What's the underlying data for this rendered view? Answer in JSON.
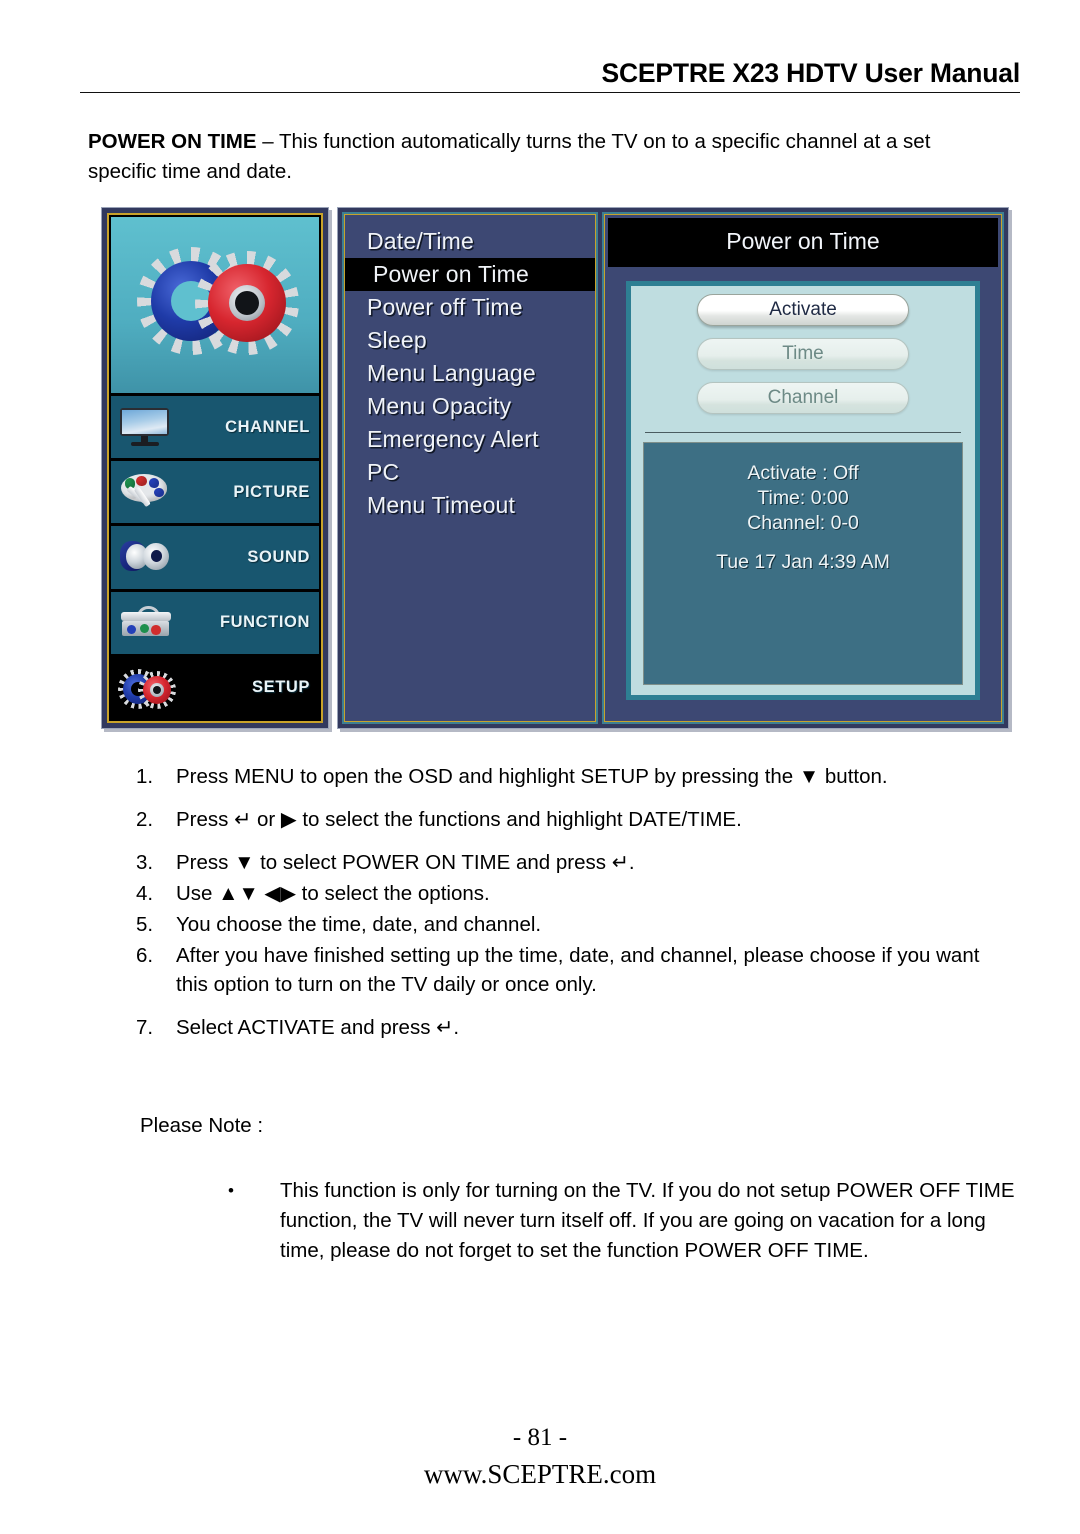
{
  "header": {
    "title": "SCEPTRE X23 HDTV User Manual"
  },
  "intro": {
    "term": "POWER ON TIME",
    "dash": " – ",
    "text": "This function automatically turns the TV on to a specific channel at a set specific time and date."
  },
  "osd": {
    "rail": {
      "hero_icon": "gears-icon",
      "items": [
        {
          "label": "CHANNEL",
          "icon": "tv-icon",
          "active": false
        },
        {
          "label": "PICTURE",
          "icon": "palette-icon",
          "active": false
        },
        {
          "label": "SOUND",
          "icon": "speaker-icon",
          "active": false
        },
        {
          "label": "FUNCTION",
          "icon": "toolbox-icon",
          "active": false
        },
        {
          "label": "SETUP",
          "icon": "gears-icon",
          "active": true
        }
      ]
    },
    "menu": {
      "items": [
        {
          "label": "Date/Time",
          "selected": false
        },
        {
          "label": "Power on Time",
          "selected": true
        },
        {
          "label": "Power off Time",
          "selected": false
        },
        {
          "label": "Sleep",
          "selected": false
        },
        {
          "label": "Menu Language",
          "selected": false
        },
        {
          "label": "Menu Opacity",
          "selected": false
        },
        {
          "label": "Emergency Alert",
          "selected": false
        },
        {
          "label": "PC",
          "selected": false
        },
        {
          "label": "Menu Timeout",
          "selected": false
        }
      ]
    },
    "detail": {
      "title": "Power on Time",
      "buttons": [
        {
          "label": "Activate",
          "active": true
        },
        {
          "label": "Time",
          "active": false
        },
        {
          "label": "Channel",
          "active": false
        }
      ],
      "status": {
        "activate": "Activate : Off",
        "time": "Time: 0:00",
        "channel": "Channel: 0-0",
        "clock": "Tue 17 Jan 4:39 AM"
      }
    },
    "colors": {
      "frame_navy": "#32395e",
      "gold_border": "#c8a22a",
      "teal_border": "#3d7f93",
      "rail_item": "#18566f",
      "menu_bg": "#3d4873",
      "detail_panel": "#bfdde0",
      "status_box": "#3d6f84",
      "highlight": "#000000"
    }
  },
  "steps": [
    {
      "num": "1.",
      "text": "Press MENU to open the OSD and highlight SETUP by pressing the ▼ button."
    },
    {
      "num": "2.",
      "text": "Press ↵ or ▶ to select the functions and highlight DATE/TIME."
    },
    {
      "num": "3.",
      "text": "Press ▼ to select POWER ON TIME and press ↵."
    },
    {
      "num": "4.",
      "text": "Use ▲▼ ◀▶ to select the options."
    },
    {
      "num": "5.",
      "text": "You choose the time, date, and channel."
    },
    {
      "num": "6.",
      "text": "After you have finished setting up the time, date, and channel, please choose if you want this option to turn on the TV daily or once only."
    },
    {
      "num": "7.",
      "text": "Select ACTIVATE and press ↵."
    }
  ],
  "note": {
    "heading": "Please Note :",
    "bullet": "•",
    "text": "This function is only for turning on the TV.  If you do not setup POWER OFF TIME function, the TV will never turn itself off.  If you are going on vacation for a long time, please do not forget to set the function POWER OFF TIME."
  },
  "footer": {
    "page": "- 81 -",
    "url": "www.SCEPTRE.com"
  }
}
